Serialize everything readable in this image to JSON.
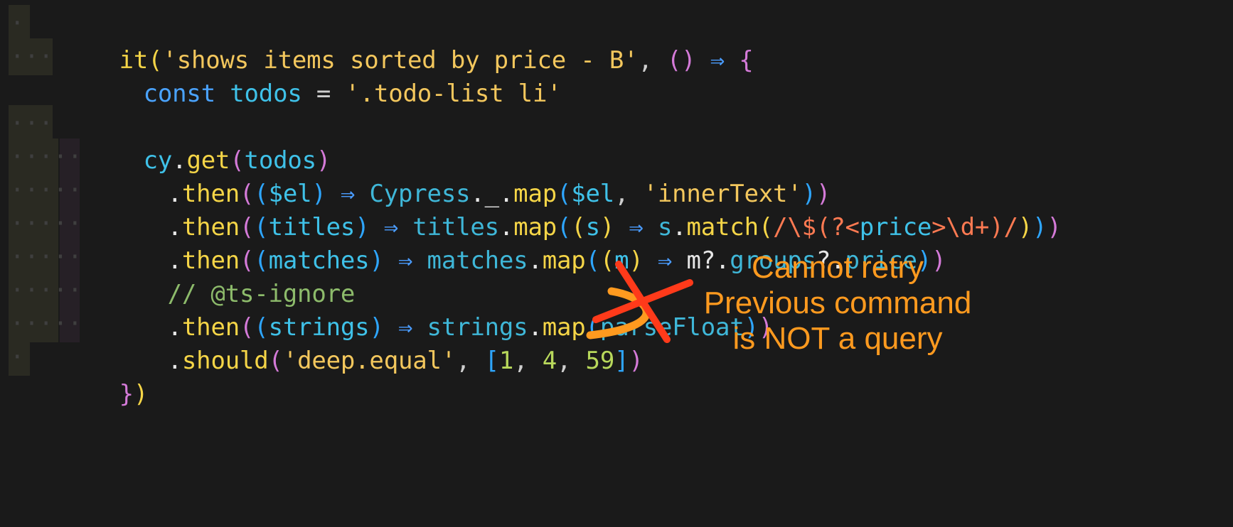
{
  "code": {
    "line1": {
      "call": "it",
      "open": "(",
      "title": "'shows items sorted by price - B'",
      "comma": ", ",
      "params": "()",
      "arrow": " ⇒ ",
      "brace": "{"
    },
    "line2": {
      "kw": "const",
      "name": "todos",
      "eq": " = ",
      "selector": "'.todo-list li'"
    },
    "line4": {
      "obj": "cy",
      "dot": ".",
      "method": "get",
      "open": "(",
      "arg": "todos",
      "close": ")"
    },
    "line5": {
      "dot": ".",
      "method": "then",
      "open": "(",
      "p_open": "(",
      "param": "$el",
      "p_close": ")",
      "arrow": " ⇒ ",
      "obj": "Cypress",
      "mid": "._.",
      "fn": "map",
      "c_open": "(",
      "arg1": "$el",
      "comma": ", ",
      "arg2": "'innerText'",
      "c_close": ")",
      "close": ")"
    },
    "line6": {
      "dot": ".",
      "method": "then",
      "open": "(",
      "p_open": "(",
      "param": "titles",
      "p_close": ")",
      "arrow": " ⇒ ",
      "obj": "titles",
      "dot2": ".",
      "fn": "map",
      "c_open": "(",
      "ip_open": "(",
      "iparam": "s",
      "ip_close": ")",
      "arrow2": " ⇒ ",
      "obj2": "s",
      "dot3": ".",
      "fn2": "match",
      "m_open": "(",
      "re1": "/\\$(?<",
      "re_group": "price",
      "re2": ">\\d+)/",
      "m_close": ")",
      "c_close": ")",
      "close": ")"
    },
    "line7": {
      "dot": ".",
      "method": "then",
      "open": "(",
      "p_open": "(",
      "param": "matches",
      "p_close": ")",
      "arrow": " ⇒ ",
      "obj": "matches",
      "dot2": ".",
      "fn": "map",
      "c_open": "(",
      "ip_open": "(",
      "iparam": "m",
      "ip_close": ")",
      "arrow2": " ⇒ ",
      "chain1": "m?.",
      "chain2": "groups",
      "chain3": "?.",
      "chain4": "price",
      "c_close": ")",
      "close": ")"
    },
    "line8": {
      "comment": "// @ts-ignore"
    },
    "line9": {
      "dot": ".",
      "method": "then",
      "open": "(",
      "p_open": "(",
      "param": "strings",
      "p_close": ")",
      "arrow": " ⇒ ",
      "obj": "strings",
      "dot2": ".",
      "fn": "map",
      "c_open": "(",
      "arg": "parseFloat",
      "c_close": ")",
      "close": ")"
    },
    "line10": {
      "dot": ".",
      "method": "should",
      "open": "(",
      "arg1": "'deep.equal'",
      "comma": ", ",
      "a_open": "[",
      "n1": "1",
      "s1": ", ",
      "n2": "4",
      "s2": ", ",
      "n3": "59",
      "a_close": "]",
      "close": ")"
    },
    "line11": {
      "brace": "}",
      "close": ")"
    }
  },
  "annotation": {
    "line1": "Cannot retry",
    "line2": "Previous command",
    "line3": "is NOT a query",
    "color": "#ff9a1f",
    "cross_color": "#ff3a1a"
  }
}
